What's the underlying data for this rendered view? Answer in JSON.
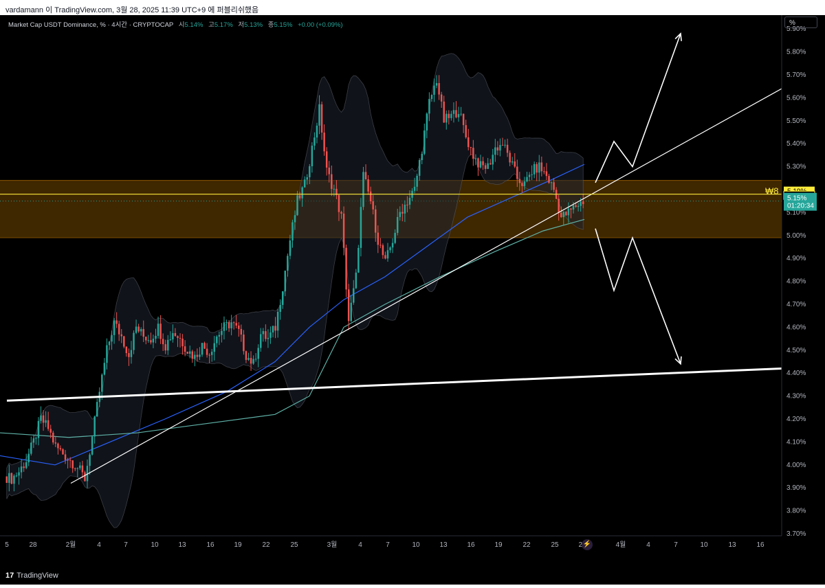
{
  "header": {
    "caption": "vardamann 이 TradingView.com, 3월 28, 2025 11:39 UTC+9 에 퍼블리쉬했음"
  },
  "legend": {
    "symbol": "Market Cap USDT Dominance, % · 4시간 · CRYPTOCAP",
    "open_label": "시",
    "open_value": "5.14%",
    "high_label": "고",
    "high_value": "5.17%",
    "low_label": "저",
    "low_value": "5.13%",
    "close_label": "종",
    "close_value": "5.15%",
    "change": "+0.00 (+0.09%)"
  },
  "scale_button": "%",
  "footer": {
    "brand": "TradingView"
  },
  "colors": {
    "background": "#000000",
    "up": "#26a69a",
    "down": "#ef5350",
    "zone": "#4a2e00",
    "zone_border": "#ff9800",
    "ma_fast": "#2962ff",
    "ma_slow": "#5fb3a8",
    "price_badge": "#26a69a",
    "level_badge": "#ffeb3b"
  },
  "chart_data": {
    "type": "candlestick",
    "y_unit": "%",
    "ylim": [
      3.65,
      5.95
    ],
    "yticks": [
      "3.70%",
      "3.80%",
      "3.90%",
      "4.00%",
      "4.10%",
      "4.20%",
      "4.30%",
      "4.40%",
      "4.50%",
      "4.60%",
      "4.70%",
      "4.80%",
      "4.90%",
      "5.00%",
      "5.10%",
      "5.20%",
      "5.30%",
      "5.40%",
      "5.50%",
      "5.60%",
      "5.70%",
      "5.80%",
      "5.90%"
    ],
    "xticks": [
      "5",
      "28",
      "2월",
      "4",
      "7",
      "10",
      "13",
      "16",
      "19",
      "22",
      "25",
      "3월",
      "4",
      "7",
      "10",
      "13",
      "16",
      "19",
      "22",
      "25",
      "28",
      "4월",
      "4",
      "7",
      "10",
      "13",
      "16"
    ],
    "price_badge": {
      "value": "5.15%",
      "countdown": "01:20:34"
    },
    "level_badges": [
      {
        "value": "5.19%",
        "marker": "₩8"
      },
      {
        "value": "5.18%"
      }
    ],
    "zone": {
      "from": 4.99,
      "to": 5.24
    },
    "close_series": [
      3.95,
      3.94,
      3.97,
      4.02,
      4.1,
      4.2,
      4.16,
      4.08,
      4.05,
      4.02,
      3.99,
      3.94,
      4.12,
      4.32,
      4.5,
      4.62,
      4.56,
      4.48,
      4.6,
      4.56,
      4.55,
      4.6,
      4.52,
      4.58,
      4.55,
      4.5,
      4.47,
      4.52,
      4.49,
      4.56,
      4.6,
      4.62,
      4.58,
      4.48,
      4.44,
      4.57,
      4.55,
      4.6,
      4.78,
      4.98,
      5.15,
      5.22,
      5.38,
      5.55,
      5.28,
      5.2,
      5.08,
      4.63,
      4.82,
      5.26,
      5.15,
      4.98,
      4.88,
      4.98,
      5.1,
      5.15,
      5.2,
      5.38,
      5.58,
      5.68,
      5.5,
      5.52,
      5.55,
      5.43,
      5.35,
      5.3,
      5.3,
      5.38,
      5.4,
      5.33,
      5.25,
      5.22,
      5.28,
      5.3,
      5.26,
      5.2,
      5.08,
      5.1,
      5.13,
      5.15
    ],
    "volatility_band": {
      "upper_width": 0.13,
      "lower_width": 0.14
    },
    "moving_averages": [
      {
        "color": "#2962ff",
        "points": [
          [
            0,
            4.04
          ],
          [
            80,
            4.0
          ],
          [
            160,
            4.1
          ],
          [
            240,
            4.2
          ],
          [
            330,
            4.32
          ],
          [
            400,
            4.45
          ],
          [
            450,
            4.6
          ],
          [
            500,
            4.72
          ],
          [
            560,
            4.82
          ],
          [
            620,
            4.95
          ],
          [
            680,
            5.08
          ],
          [
            740,
            5.16
          ],
          [
            800,
            5.24
          ],
          [
            850,
            5.31
          ]
        ]
      },
      {
        "color": "#5fb3a8",
        "points": [
          [
            0,
            4.14
          ],
          [
            100,
            4.12
          ],
          [
            200,
            4.14
          ],
          [
            300,
            4.18
          ],
          [
            400,
            4.22
          ],
          [
            450,
            4.3
          ],
          [
            500,
            4.6
          ],
          [
            560,
            4.7
          ],
          [
            640,
            4.82
          ],
          [
            720,
            4.93
          ],
          [
            790,
            5.02
          ],
          [
            850,
            5.07
          ]
        ]
      }
    ],
    "drawn_lines": [
      {
        "from": [
          "2월",
          3.92
        ],
        "to": [
          "4월+",
          5.64
        ],
        "weight": "thin"
      },
      {
        "from": [
          "5",
          4.28
        ],
        "to": [
          "4월+",
          4.42
        ],
        "weight": "thick"
      },
      {
        "from": [
          "",
          5.18
        ],
        "to": [
          "",
          5.18
        ],
        "weight": "thin",
        "color": "#ffeb3b"
      }
    ],
    "projection_paths": [
      {
        "direction": "up",
        "points": [
          [
            "28",
            5.23
          ],
          [
            "4월",
            5.41
          ],
          [
            "4월",
            5.3
          ],
          [
            "7",
            5.88
          ]
        ]
      },
      {
        "direction": "down",
        "points": [
          [
            "28",
            5.03
          ],
          [
            "4월",
            4.76
          ],
          [
            "4월",
            4.99
          ],
          [
            "7",
            4.44
          ]
        ]
      }
    ]
  }
}
